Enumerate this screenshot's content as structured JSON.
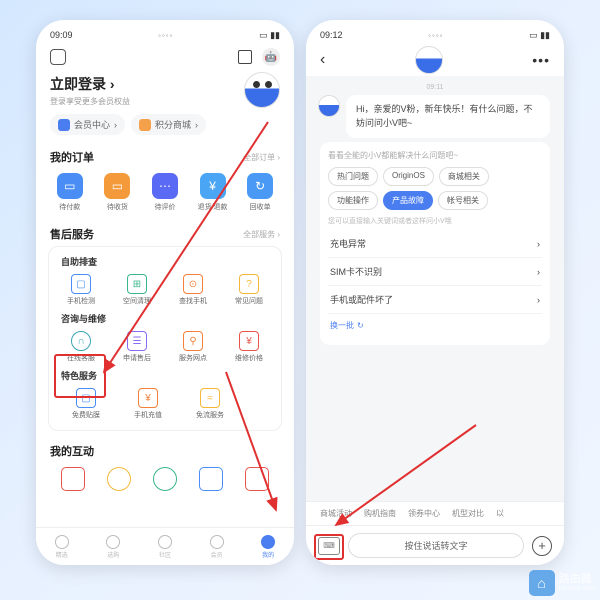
{
  "left": {
    "status_time": "09:09",
    "login_title": "立即登录",
    "login_arrow": "›",
    "login_sub": "登录享受更多会员权益",
    "pills": [
      "会员中心",
      "积分商城"
    ],
    "orders_title": "我的订单",
    "orders_more": "全部订单 ›",
    "orders": [
      "待付款",
      "待收货",
      "待评价",
      "退货/退款",
      "回收单"
    ],
    "service_title": "售后服务",
    "service_more": "全部服务 ›",
    "self_check": "自助排查",
    "self_items": [
      "手机检测",
      "空间清理",
      "查找手机",
      "常见问题"
    ],
    "repair_title": "咨询与维修",
    "repair_items": [
      "在线客服",
      "申请售后",
      "服务网点",
      "维修价格"
    ],
    "special_title": "特色服务",
    "special_items": [
      "免费贴膜",
      "手机充值",
      "免流服务"
    ],
    "interact_title": "我的互动",
    "nav": [
      "精选",
      "选购",
      "社区",
      "会员",
      "我的"
    ]
  },
  "right": {
    "status_time": "09:12",
    "chat_time": "09:11",
    "greeting": "Hi，亲爱的V粉，新年快乐！有什么问题，不妨问问小V吧~",
    "chip_header": "看看全能的小V都能解决什么问题吧~",
    "chips": [
      "热门问题",
      "OriginOS",
      "商城相关",
      "功能操作",
      "产品故障",
      "帐号相关"
    ],
    "kw_hint": "您可以直接输入关键词或者这样问小V哦",
    "faq": [
      "充电异常",
      "SIM卡不识别",
      "手机或配件坏了"
    ],
    "refresh": "换一批",
    "tags": [
      "商城活动",
      "购机指南",
      "领券中心",
      "机型对比",
      "以"
    ],
    "voice_hint": "按住说话转文字"
  },
  "watermark": {
    "title": "路由器",
    "sub": "luyouqi.com"
  }
}
